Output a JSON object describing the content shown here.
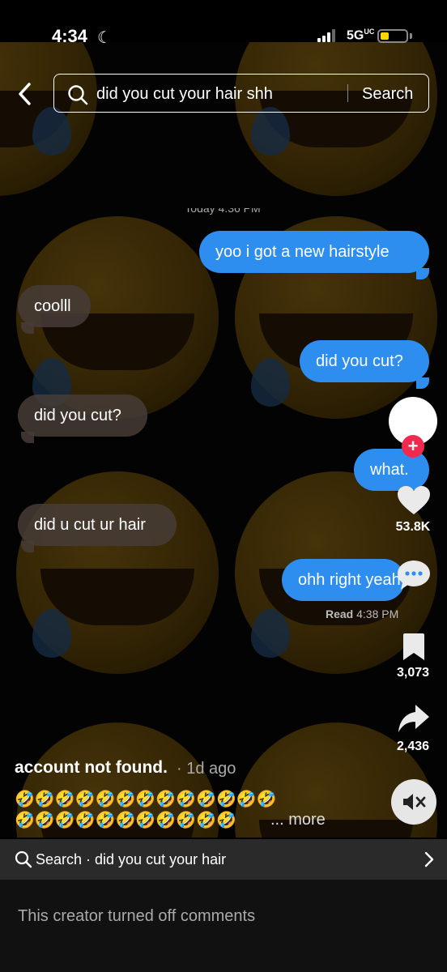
{
  "status_bar": {
    "time": "4:34",
    "network": "5G",
    "network_sub": "UC"
  },
  "search": {
    "query": "did you cut your hair shh",
    "button_label": "Search"
  },
  "chat": {
    "cut_timestamp": "Today 4:36 PM",
    "messages": [
      {
        "side": "out",
        "text": "yoo i got a new hairstyle"
      },
      {
        "side": "in",
        "text": "coolll"
      },
      {
        "side": "out",
        "text": "did you cut?"
      },
      {
        "side": "in",
        "text": "did you cut?"
      },
      {
        "side": "out",
        "text": "what."
      },
      {
        "side": "in",
        "text": "did u cut ur hair"
      },
      {
        "side": "out",
        "text": "ohh right yeah"
      }
    ],
    "read_label": "Read",
    "read_time": "4:38 PM"
  },
  "actions": {
    "likes": "53.8K",
    "saves": "3,073",
    "shares": "2,436"
  },
  "caption": {
    "author": "account not found.",
    "ago": "· 1d ago",
    "emoji_line1": "🤣🤣🤣🤣🤣🤣🤣🤣🤣🤣🤣🤣🤣",
    "emoji_line2": "🤣🤣🤣🤣🤣🤣🤣🤣🤣🤣🤣",
    "more": "... more"
  },
  "search_strip": {
    "text": "Search · did you cut your hair"
  },
  "comments": {
    "notice": "This creator turned off comments"
  },
  "colors": {
    "outgoing_bubble": "#2d8ef0",
    "follow_badge": "#f0294f",
    "battery": "#ffd500"
  }
}
